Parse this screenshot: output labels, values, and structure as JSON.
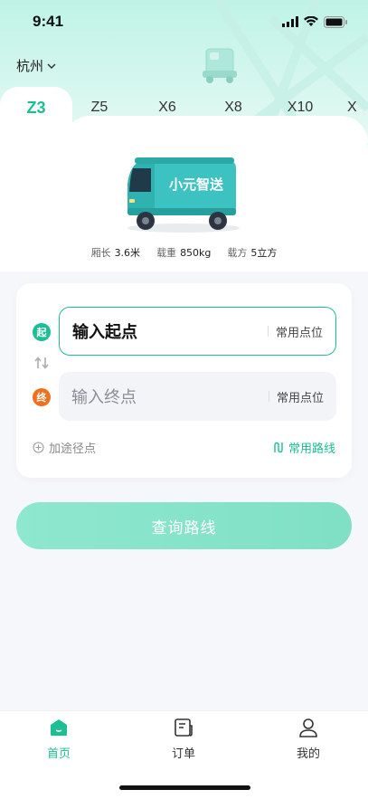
{
  "status_bar": {
    "time": "9:41"
  },
  "header": {
    "city": "杭州"
  },
  "model_tabs": [
    "Z3",
    "Z5",
    "X6",
    "X8",
    "X10",
    "X"
  ],
  "active_tab": "Z3",
  "vehicle": {
    "brand_text": "小元智送",
    "specs": [
      {
        "label": "厢长",
        "value": "3.6米"
      },
      {
        "label": "载重",
        "value": "850kg"
      },
      {
        "label": "载方",
        "value": "5立方"
      }
    ]
  },
  "route": {
    "start_badge": "起",
    "end_badge": "终",
    "start_placeholder": "输入起点",
    "end_placeholder": "输入终点",
    "favorite_points": "常用点位",
    "add_stop": "加途径点",
    "common_routes": "常用路线"
  },
  "query_button": "查询路线",
  "tabbar": [
    {
      "label": "首页",
      "active": true
    },
    {
      "label": "订单",
      "active": false
    },
    {
      "label": "我的",
      "active": false
    }
  ],
  "colors": {
    "accent": "#1bbf93",
    "end_point": "#f0701e",
    "truck_body": "#3cc2c0"
  }
}
